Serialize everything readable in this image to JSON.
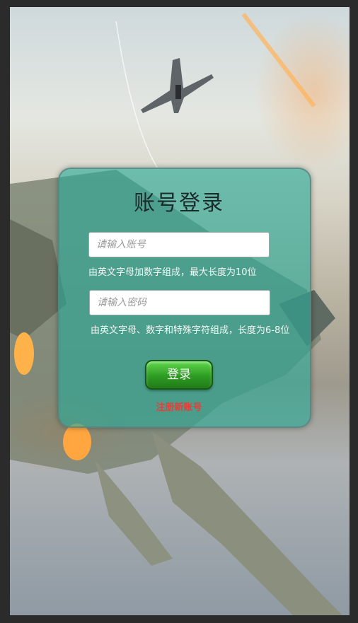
{
  "login": {
    "title": "账号登录",
    "account_placeholder": "请输入账号",
    "account_hint": "由英文字母加数字组成，最大长度为10位",
    "password_placeholder": "请输入密码",
    "password_hint": "由英文字母、数字和特殊字符组成，长度为6-8位",
    "login_button": "登录",
    "register_link": "注册新账号"
  },
  "colors": {
    "panel": "#28aa96",
    "button": "#2e9c24",
    "register_link": "#e2403a"
  }
}
